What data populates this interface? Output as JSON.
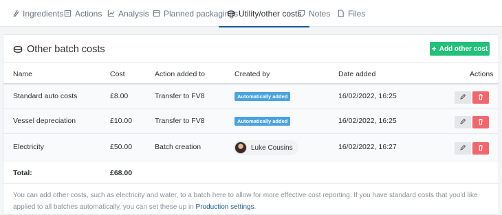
{
  "tabs": [
    {
      "label": "Ingredients",
      "icon": "flask-icon"
    },
    {
      "label": "Actions",
      "icon": "document-icon"
    },
    {
      "label": "Analysis",
      "icon": "chart-icon"
    },
    {
      "label": "Planned packagings",
      "icon": "package-icon"
    },
    {
      "label": "Utility/other costs",
      "icon": "coins-icon",
      "active": true
    },
    {
      "label": "Notes",
      "icon": "note-icon"
    },
    {
      "label": "Files",
      "icon": "file-icon"
    }
  ],
  "card": {
    "title": "Other batch costs",
    "add_button": "Add other cost"
  },
  "table": {
    "headers": [
      "Name",
      "Cost",
      "Action added to",
      "Created by",
      "Date added",
      "Actions"
    ],
    "rows": [
      {
        "name": "Standard auto costs",
        "cost": "£8.00",
        "action": "Transfer to FV8",
        "created_by": "Automatically added",
        "created_type": "badge",
        "date": "16/02/2022, 16:25"
      },
      {
        "name": "Vessel depreciation",
        "cost": "£10.00",
        "action": "Transfer to FV8",
        "created_by": "Automatically added",
        "created_type": "badge",
        "date": "16/02/2022, 16:25"
      },
      {
        "name": "Electricity",
        "cost": "£50.00",
        "action": "Batch creation",
        "created_by": "Luke Cousins",
        "created_type": "user",
        "date": "16/02/2022, 16:27"
      }
    ],
    "total_label": "Total:",
    "total_value": "£68.00"
  },
  "note": {
    "text_before": "You can add other costs, such as electricity and water, to a batch here to allow for more effective cost reporting. If you have standard costs that you'd like applied to all batches automatically, you can set these up in ",
    "link": "Production settings",
    "text_after": "."
  },
  "colors": {
    "accent": "#1f5b8a",
    "add_button": "#22c07a",
    "badge": "#4aa3df",
    "delete": "#f0686e"
  }
}
